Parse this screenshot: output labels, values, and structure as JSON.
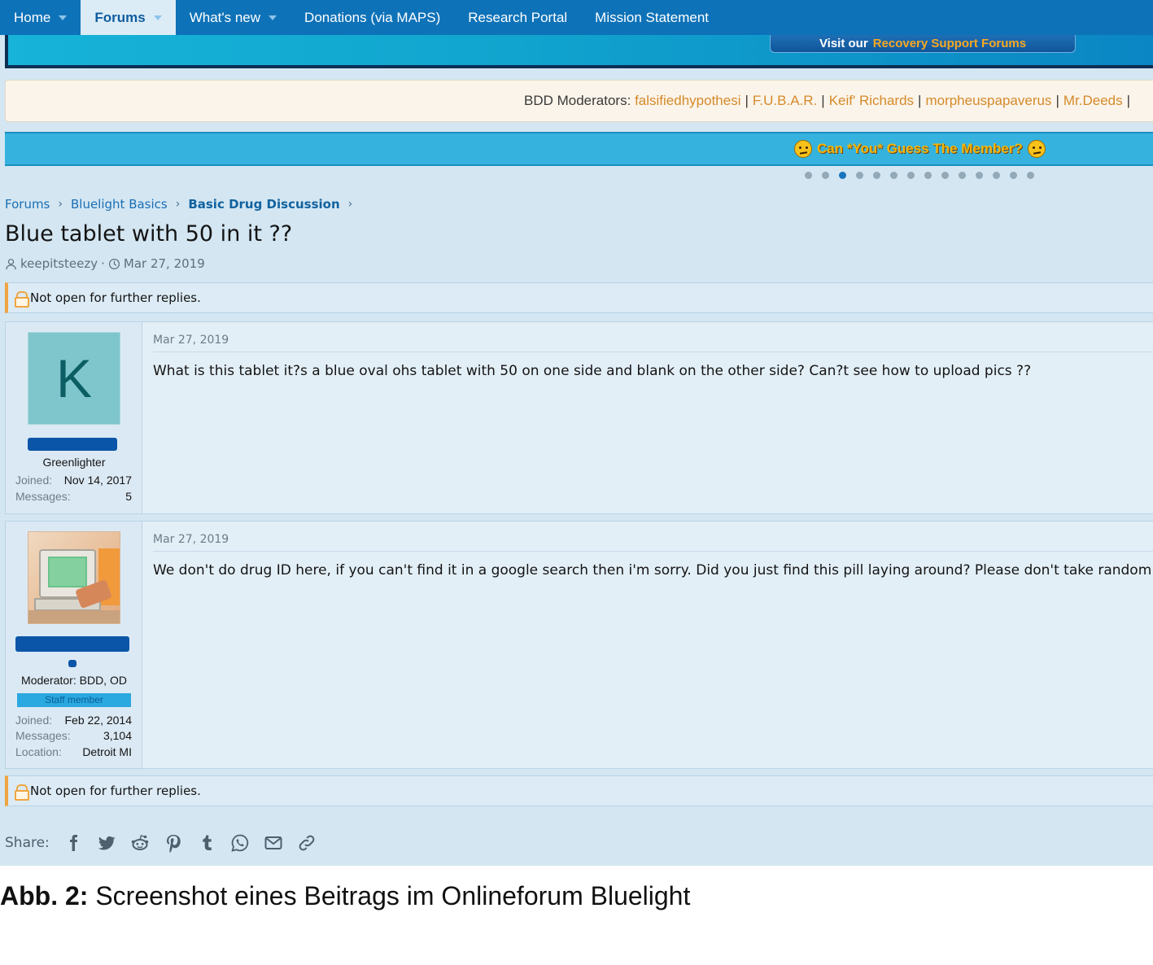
{
  "nav": {
    "items": [
      {
        "label": "Home",
        "dropdown": true,
        "active": false
      },
      {
        "label": "Forums",
        "dropdown": true,
        "active": true
      },
      {
        "label": "What's new",
        "dropdown": true,
        "active": false
      },
      {
        "label": "Donations (via MAPS)",
        "dropdown": false,
        "active": false
      },
      {
        "label": "Research Portal",
        "dropdown": false,
        "active": false
      },
      {
        "label": "Mission Statement",
        "dropdown": false,
        "active": false
      }
    ]
  },
  "banner": {
    "recovery_prefix": "Visit our",
    "recovery_link": "Recovery Support Forums"
  },
  "moderators": {
    "label": "BDD Moderators:",
    "names": [
      "falsifiedhypothesi",
      "F.U.B.A.R.",
      "Keif' Richards",
      "morpheuspapaverus",
      "Mr.Deeds"
    ],
    "separator": "|"
  },
  "guess": {
    "text": "Can *You* Guess The Member?"
  },
  "carousel": {
    "count": 14,
    "active_index": 2
  },
  "breadcrumb": [
    "Forums",
    "Bluelight Basics",
    "Basic Drug Discussion"
  ],
  "thread": {
    "title": "Blue tablet with 50 in it ??",
    "author": "keepitsteezy",
    "date": "Mar 27, 2019",
    "date_sep": "·"
  },
  "notice": {
    "text": "Not open for further replies."
  },
  "posts": [
    {
      "date": "Mar 27, 2019",
      "body": "What is this tablet it?s a blue oval ohs tablet with 50 on one side and blank on the other side? Can?t see how to upload pics ??",
      "avatar_letter": "K",
      "user_title": "Greenlighter",
      "stats": [
        {
          "k": "Joined:",
          "v": "Nov 14, 2017"
        },
        {
          "k": "Messages:",
          "v": "5"
        }
      ]
    },
    {
      "date": "Mar 27, 2019",
      "body": "We don't do drug ID here, if you can't find it in a google search then i'm sorry. Did you just find this pill laying around? Please don't take random pills.",
      "user_title": "Moderator: BDD, OD",
      "staff_badge": "Staff member",
      "stats": [
        {
          "k": "Joined:",
          "v": "Feb 22, 2014"
        },
        {
          "k": "Messages:",
          "v": "3,104"
        },
        {
          "k": "Location:",
          "v": "Detroit MI"
        }
      ]
    }
  ],
  "share": {
    "label": "Share:",
    "icons": [
      "facebook-icon",
      "twitter-icon",
      "reddit-icon",
      "pinterest-icon",
      "tumblr-icon",
      "whatsapp-icon",
      "email-icon",
      "link-icon"
    ]
  },
  "caption": {
    "label": "Abb. 2:",
    "text": "Screenshot eines Beitrags im Onlineforum Bluelight"
  },
  "colors": {
    "nav_bg": "#0e72b8",
    "link": "#1a6fb4",
    "moderator_name": "#d58a2a",
    "notice_accent": "#f0a540",
    "redaction": "#0b55a8"
  }
}
